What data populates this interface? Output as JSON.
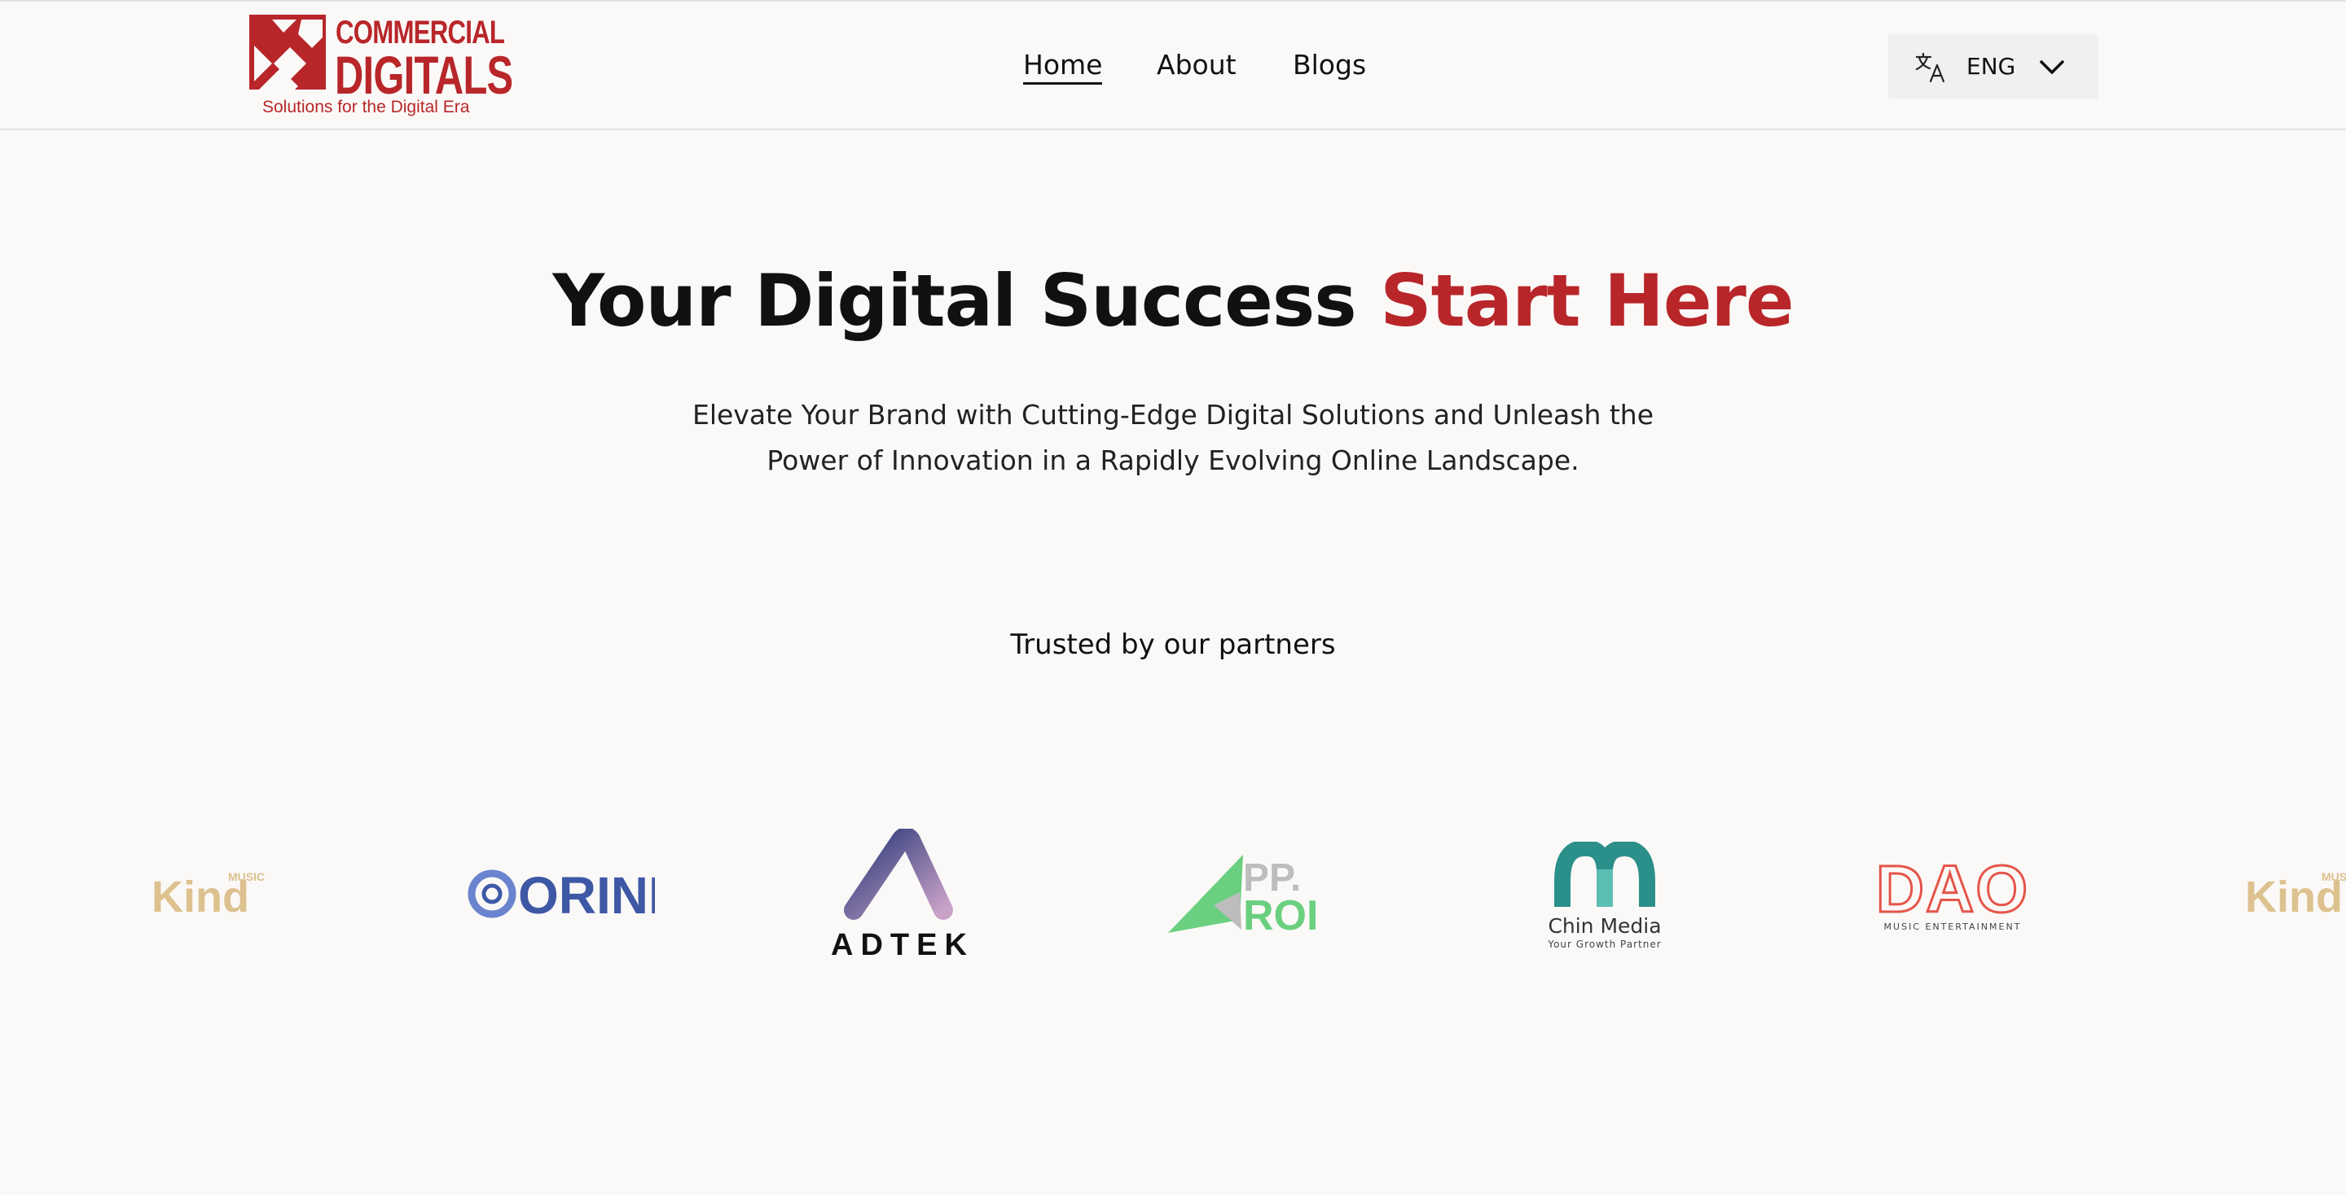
{
  "header": {
    "logo": {
      "line1": "COMMERCIAL",
      "line2": "DIGITALS",
      "tagline": "Solutions for the Digital Era",
      "brand_color": "#b8262a"
    },
    "nav": [
      {
        "label": "Home",
        "active": true
      },
      {
        "label": "About",
        "active": false
      },
      {
        "label": "Blogs",
        "active": false
      }
    ],
    "language": {
      "icon": "translate-icon",
      "label": "ENG",
      "chevron": "chevron-down-icon"
    }
  },
  "hero": {
    "title_main": "Your Digital Success",
    "title_accent": "Start Here",
    "subtitle": "Elevate Your Brand with Cutting-Edge Digital Solutions and Unleash the Power of Innovation in a Rapidly Evolving Online Landscape.",
    "accent_color": "#b8262a"
  },
  "partners": {
    "heading": "Trusted by our partners",
    "logos": [
      {
        "name": "Kind Music",
        "text": "Kind",
        "small_text": "MUSIC"
      },
      {
        "name": "ORINN",
        "text": "ORINN"
      },
      {
        "name": "ADTEK",
        "text": "ADTEK"
      },
      {
        "name": "PP.ROI",
        "text_top": "PP.",
        "text_bottom": "ROI"
      },
      {
        "name": "Chin Media",
        "text": "Chin Media",
        "small_text": "Your Growth Partner"
      },
      {
        "name": "DAO Music Entertainment",
        "text": "DAO",
        "small_text": "MUSIC ENTERTAINMENT"
      },
      {
        "name": "Kind Music",
        "text": "Kind",
        "small_text": "MUSIC"
      }
    ]
  }
}
